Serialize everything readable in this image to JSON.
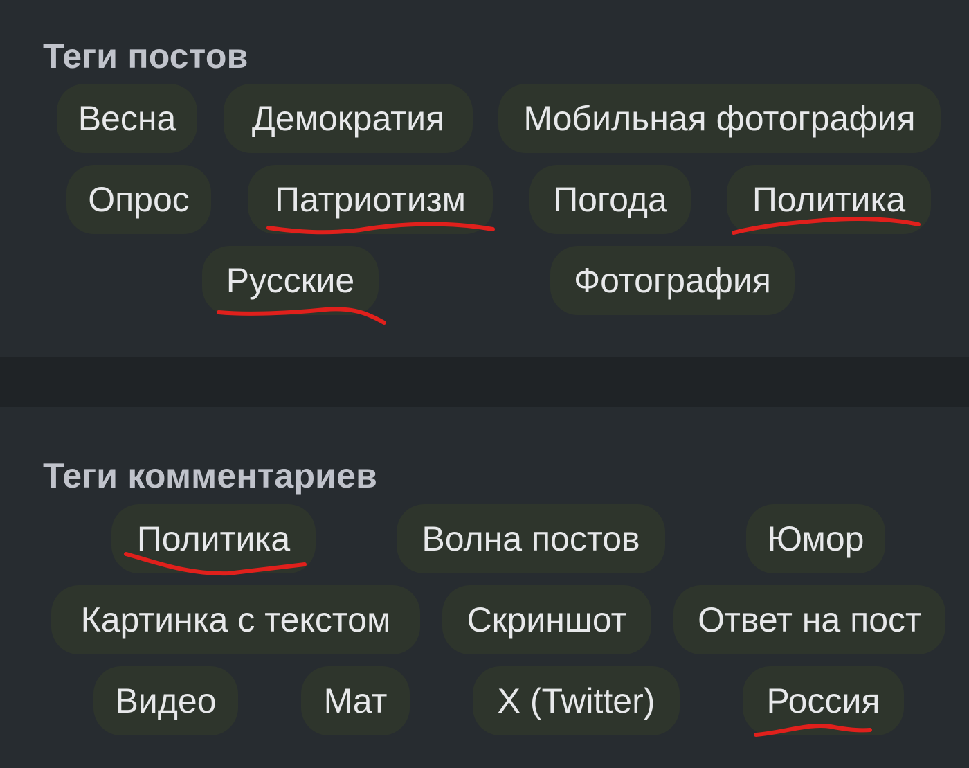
{
  "post_tags": {
    "heading": "Теги постов",
    "tags": [
      "Весна",
      "Демократия",
      "Мобильная фотография",
      "Опрос",
      "Патриотизм",
      "Погода",
      "Политика",
      "Русские",
      "Фотография"
    ],
    "underlined": [
      "Патриотизм",
      "Политика",
      "Русские"
    ]
  },
  "comment_tags": {
    "heading": "Теги комментариев",
    "tags": [
      "Политика",
      "Волна постов",
      "Юмор",
      "Картинка с текстом",
      "Скриншот",
      "Ответ на пост",
      "Видео",
      "Мат",
      "X (Twitter)",
      "Россия"
    ],
    "underlined": [
      "Политика",
      "Россия"
    ]
  },
  "colors": {
    "background": "#272c30",
    "tag_background": "#2e352c",
    "tag_text": "#e7e8ea",
    "heading_text": "#c0c3cb",
    "underline_mark": "#e0201c"
  }
}
